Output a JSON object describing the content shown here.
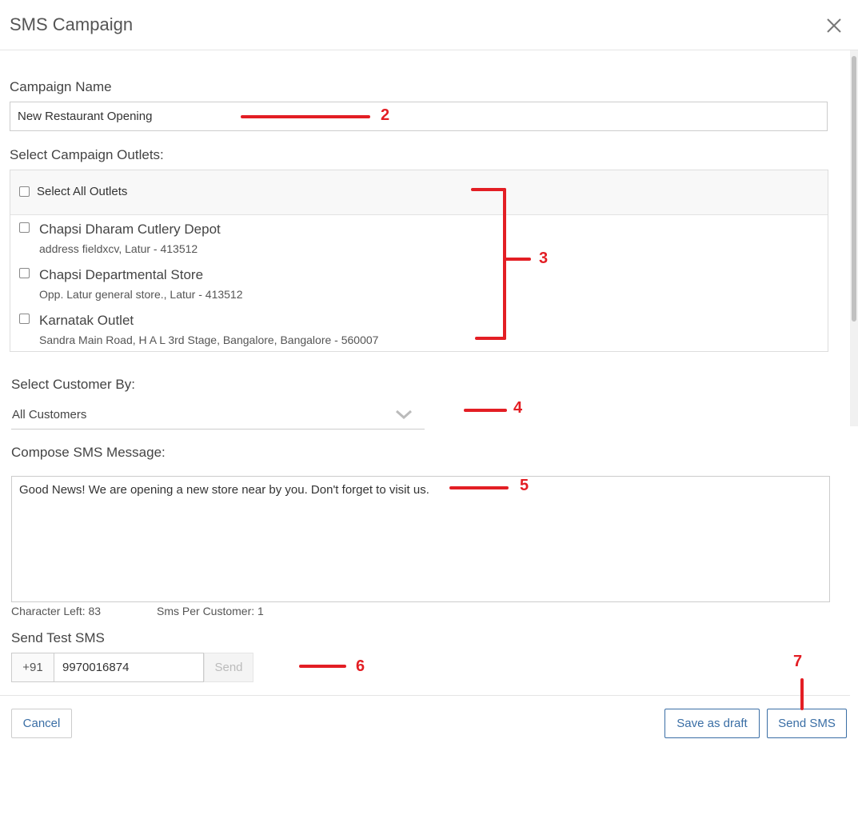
{
  "modal": {
    "title": "SMS Campaign",
    "close_icon": "close-icon"
  },
  "campaign_name": {
    "label": "Campaign Name",
    "value": "New Restaurant Opening"
  },
  "outlets": {
    "label": "Select Campaign Outlets:",
    "select_all_label": "Select All Outlets",
    "items": [
      {
        "name": "Chapsi Dharam Cutlery Depot",
        "address": "address fieldxcv, Latur - 413512"
      },
      {
        "name": "Chapsi Departmental Store",
        "address": "Opp. Latur general store., Latur - 413512"
      },
      {
        "name": "Karnatak Outlet",
        "address": "Sandra Main Road, H A L 3rd Stage, Bangalore, Bangalore - 560007"
      }
    ]
  },
  "customer": {
    "label": "Select Customer By:",
    "selected": "All Customers",
    "icon": "chevron-down-icon"
  },
  "message": {
    "label": "Compose SMS Message:",
    "value": "Good News! We are opening a new store near by you. Don't forget to visit us.",
    "chars_left": "Character Left: 83",
    "sms_per_customer": "Sms Per Customer: 1"
  },
  "test_sms": {
    "label": "Send Test SMS",
    "prefix": "+91",
    "phone": "9970016874",
    "send_label": "Send"
  },
  "footer": {
    "cancel_label": "Cancel",
    "draft_label": "Save as draft",
    "send_label": "Send SMS"
  },
  "annotations": {
    "m2": "2",
    "m3": "3",
    "m4": "4",
    "m5": "5",
    "m6": "6",
    "m7": "7"
  },
  "colors": {
    "accent": "#3a6ea5",
    "annotation": "#e31e24"
  }
}
